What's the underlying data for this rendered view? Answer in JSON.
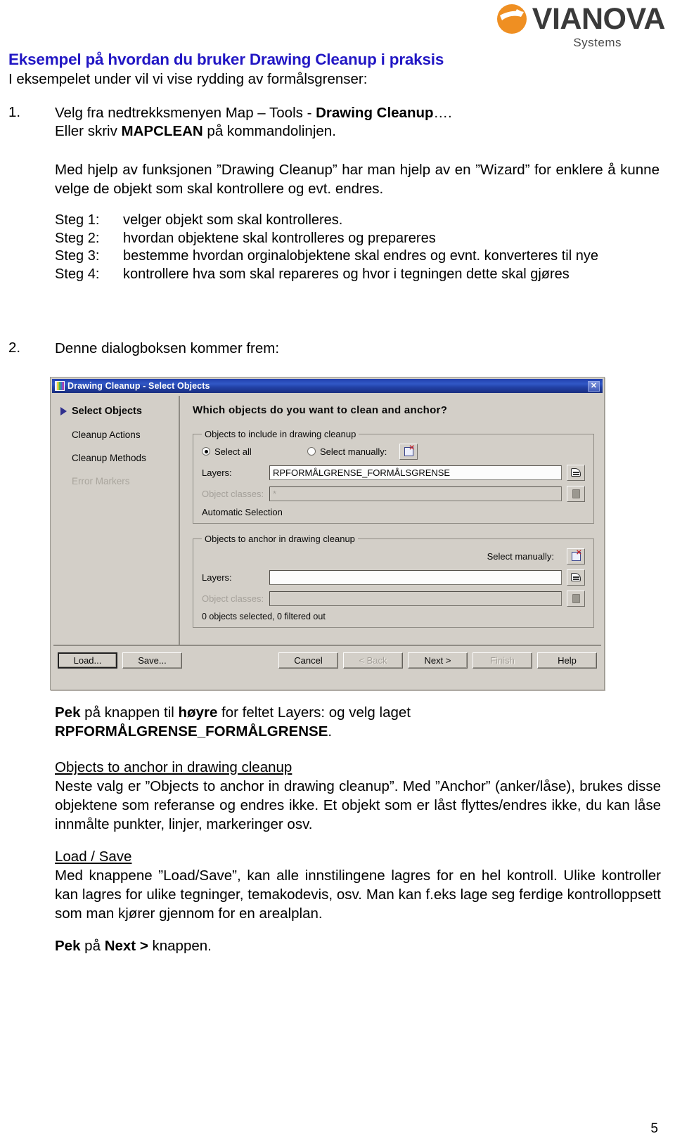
{
  "brand": {
    "name": "VIANOVA",
    "sub": "Systems",
    "mark_icon": "vianova-circle-swoosh-icon",
    "accent_orange": "#ef8f22",
    "word_color": "#3a3a3a"
  },
  "title": "Eksempel på hvordan du bruker Drawing Cleanup i praksis",
  "title_color": "#2116c4",
  "subtitle": "I eksempelet under vil vi vise rydding av formålsgrenser:",
  "list": [
    {
      "marker": "1.",
      "line1_a": "Velg fra nedtrekksmenyen Map – Tools - ",
      "line1_b": "Drawing Cleanup",
      "line1_c": "….",
      "line2_a": "Eller skriv ",
      "line2_b": "MAPCLEAN",
      "line2_c": " på kommandolinjen."
    },
    {
      "marker": "2.",
      "text": "Denne dialogboksen kommer frem:"
    }
  ],
  "intro_paragraph": "Med hjelp av funksjonen ”Drawing Cleanup” har man hjelp av en ”Wizard” for enklere å kunne velge de objekt som skal kontrollere og evt. endres.",
  "steps": [
    {
      "label": "Steg 1:",
      "text": "velger objekt som skal kontrolleres."
    },
    {
      "label": "Steg 2:",
      "text": "hvordan objektene skal kontrolleres og prepareres"
    },
    {
      "label": "Steg 3:",
      "text": "bestemme hvordan orginalobjektene skal endres og evnt. konverteres til nye"
    },
    {
      "label": "Steg 4:",
      "text": "kontrollere hva som skal repareres og hvor i tegningen dette skal gjøres"
    }
  ],
  "dialog": {
    "titlebar": {
      "title": "Drawing Cleanup - Select Objects",
      "window_icon": "app-window-icon",
      "close_label": "✕"
    },
    "nav": [
      {
        "label": "Select Objects",
        "state": "active"
      },
      {
        "label": "Cleanup Actions",
        "state": "normal"
      },
      {
        "label": "Cleanup Methods",
        "state": "normal"
      },
      {
        "label": "Error Markers",
        "state": "disabled"
      }
    ],
    "heading": "Which objects do you want to clean and anchor?",
    "include_group": {
      "legend": "Objects to include in drawing cleanup",
      "select_all_label": "Select all",
      "select_all_checked": true,
      "select_manually_label": "Select manually:",
      "select_manually_checked": false,
      "select_icon": "select-objects-icon",
      "layers_label": "Layers:",
      "layers_value": "RPFORMÅLGRENSE_FORMÅLSGRENSE",
      "layers_btn_icon": "layers-picker-icon",
      "object_classes_label": "Object classes:",
      "object_classes_value": "*",
      "object_classes_btn_icon": "object-classes-icon",
      "automatic_selection_label": "Automatic Selection"
    },
    "anchor_group": {
      "legend": "Objects to anchor in drawing cleanup",
      "select_manually_label": "Select manually:",
      "select_icon": "select-objects-icon",
      "layers_label": "Layers:",
      "layers_value": "",
      "layers_btn_icon": "layers-picker-icon",
      "object_classes_label": "Object classes:",
      "object_classes_value": "",
      "object_classes_btn_icon": "object-classes-icon",
      "status": "0 objects selected, 0 filtered out"
    },
    "buttons": [
      {
        "label": "Load...",
        "state": "default"
      },
      {
        "label": "Save...",
        "state": "normal"
      },
      {
        "label": "Cancel",
        "state": "normal"
      },
      {
        "label": "< Back",
        "state": "disabled"
      },
      {
        "label": "Next >",
        "state": "normal"
      },
      {
        "label": "Finish",
        "state": "disabled"
      },
      {
        "label": "Help",
        "state": "normal"
      }
    ]
  },
  "after": {
    "p1_a": "Pek",
    "p1_b": " på knappen til ",
    "p1_c": "høyre",
    "p1_d": " for feltet Layers: og velg laget",
    "p1_e": "RPFORMÅLGRENSE_FORMÅLGRENSE",
    "p1_f": ".",
    "h1": "Objects to anchor in drawing cleanup",
    "p2": "Neste valg er ”Objects to anchor in drawing cleanup”. Med ”Anchor” (anker/låse), brukes disse objektene som referanse og endres ikke.  Et objekt som er låst flyttes/endres ikke, du kan låse innmålte punkter, linjer, markeringer osv.",
    "h2": "Load / Save",
    "p3": "Med knappene  ”Load/Save”, kan alle innstilingene lagres for en hel kontroll. Ulike kontroller kan lagres for ulike tegninger, temakodevis, osv. Man kan f.eks lage seg ferdige kontrolloppsett som man kjører gjennom for en arealplan.",
    "p4_a": "Pek",
    "p4_b": " på ",
    "p4_c": "Next >",
    "p4_d": " knappen."
  },
  "page_number": "5"
}
